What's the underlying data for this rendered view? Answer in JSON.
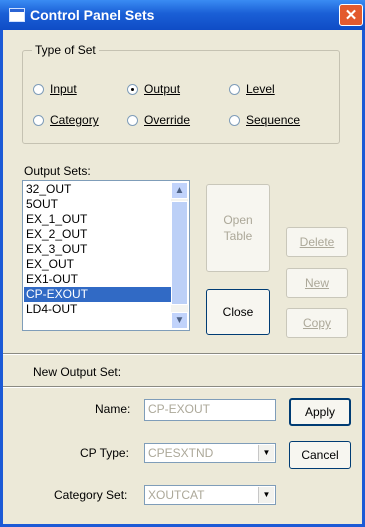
{
  "window": {
    "title": "Control Panel Sets",
    "close_glyph": "✕"
  },
  "type_of_set": {
    "legend": "Type of Set",
    "options": [
      {
        "label": "Input",
        "selected": false
      },
      {
        "label": "Output",
        "selected": true
      },
      {
        "label": "Level",
        "selected": false
      },
      {
        "label": "Category",
        "selected": false
      },
      {
        "label": "Override",
        "selected": false
      },
      {
        "label": "Sequence",
        "selected": false
      }
    ]
  },
  "output_sets": {
    "label": "Output Sets:",
    "items": [
      "32_OUT",
      "5OUT",
      "EX_1_OUT",
      "EX_2_OUT",
      "EX_3_OUT",
      "EX_OUT",
      "EX1-OUT",
      "CP-EXOUT",
      "LD4-OUT"
    ],
    "selected": "CP-EXOUT"
  },
  "buttons": {
    "open_table": "Open Table",
    "close": "Close",
    "delete": "Delete",
    "new": "New",
    "copy": "Copy",
    "apply": "Apply",
    "cancel": "Cancel"
  },
  "new_set": {
    "heading": "New Output Set:",
    "name_label": "Name:",
    "name_value": "CP-EXOUT",
    "cp_type_label": "CP Type:",
    "cp_type_value": "CPESXTND",
    "category_label": "Category Set:",
    "category_value": "XOUTCAT"
  }
}
